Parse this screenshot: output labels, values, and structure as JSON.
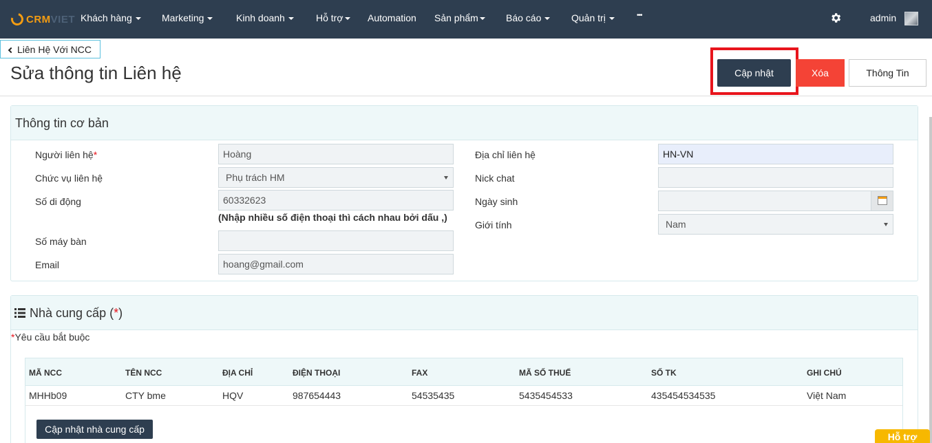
{
  "brand": {
    "part1": "CRM",
    "part2": "VIET"
  },
  "nav": {
    "items": [
      {
        "label": "Khách hàng",
        "caret": true
      },
      {
        "label": "Marketing",
        "caret": true
      },
      {
        "label": "Kinh doanh",
        "caret": true
      },
      {
        "label": "Hỗ trợ",
        "caret": true
      },
      {
        "label": "Automation",
        "caret": false
      },
      {
        "label": "Sản phẩm",
        "caret": true
      },
      {
        "label": "Báo cáo",
        "caret": true
      },
      {
        "label": "Quản trị",
        "caret": true
      }
    ],
    "more_label": "•••",
    "user_name": "admin"
  },
  "header": {
    "back_label": "Liên Hệ Với NCC",
    "title": "Sửa thông tin Liên hệ",
    "update_label": "Cập nhật",
    "delete_label": "Xóa",
    "info_label": "Thông Tin"
  },
  "basic": {
    "heading": "Thông tin cơ bản",
    "contact_person": {
      "label": "Người liên hệ",
      "required_mark": "*",
      "value": "Hoàng"
    },
    "position": {
      "label": "Chức vụ liên hệ",
      "value": "Phụ trách HM"
    },
    "mobile": {
      "label": "Số di động",
      "value": "60332623",
      "note": "(Nhập nhiều số điện thoại thì cách nhau bởi dấu ,)"
    },
    "landline": {
      "label": "Số máy bàn",
      "value": ""
    },
    "email": {
      "label": "Email",
      "value": "hoang@gmail.com"
    },
    "address": {
      "label": "Địa chỉ liên hệ",
      "value": "HN-VN"
    },
    "nick_chat": {
      "label": "Nick chat",
      "value": ""
    },
    "birthday": {
      "label": "Ngày sinh",
      "value": ""
    },
    "gender": {
      "label": "Giới tính",
      "value": "Nam"
    }
  },
  "supplier": {
    "heading": "Nhà cung cấp (",
    "heading_req": "*",
    "heading_end": ")",
    "required_mark": "*",
    "required_note": "Yêu cầu bắt buộc",
    "columns": [
      "MÃ NCC",
      "TÊN NCC",
      "ĐỊA CHỈ",
      "ĐIỆN THOẠI",
      "FAX",
      "MÃ SỐ THUẾ",
      "SỐ TK",
      "GHI CHÚ"
    ],
    "row": [
      "MHHb09",
      "CTY bme",
      "HQV",
      "987654443",
      "54535435",
      "5435454533",
      "435454534535",
      "Việt Nam"
    ],
    "update_button": "Cập nhật nhà cung cấp"
  },
  "help_tab": "Hỗ trợ",
  "colors": {
    "navbar": "#2e3e50",
    "accent": "#f39c12",
    "danger": "#f44336",
    "highlight": "#e8141c"
  }
}
